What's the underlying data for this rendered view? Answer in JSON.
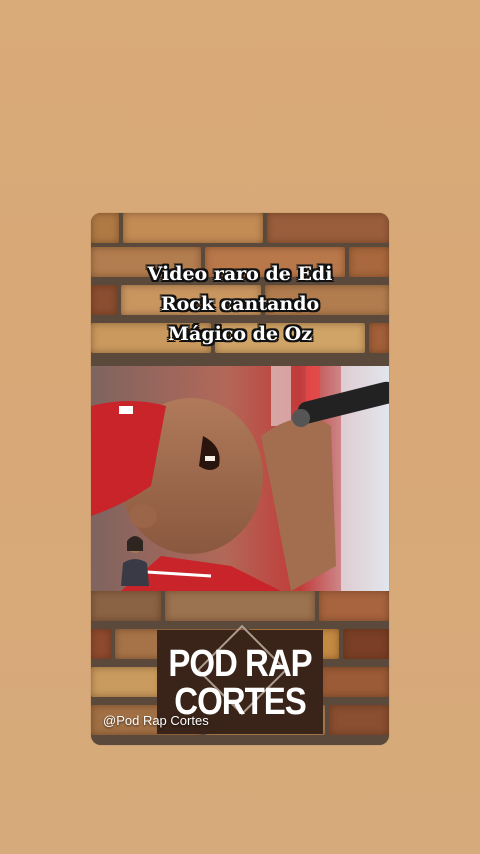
{
  "post": {
    "title": "Video raro de Edi Rock cantando Mágico de Oz",
    "logo_line1": "POD RAP",
    "logo_line2": "CORTES",
    "handle": "@Pod Rap Cortes"
  },
  "colors": {
    "background": "#d9ab78",
    "title_text": "#ffffff",
    "title_outline": "#111111",
    "logo_bg": "#3a2419",
    "cap_red": "#c8242a"
  },
  "icons": {
    "microphone": "microphone-icon",
    "sign_language_interpreter": "interpreter-icon"
  }
}
